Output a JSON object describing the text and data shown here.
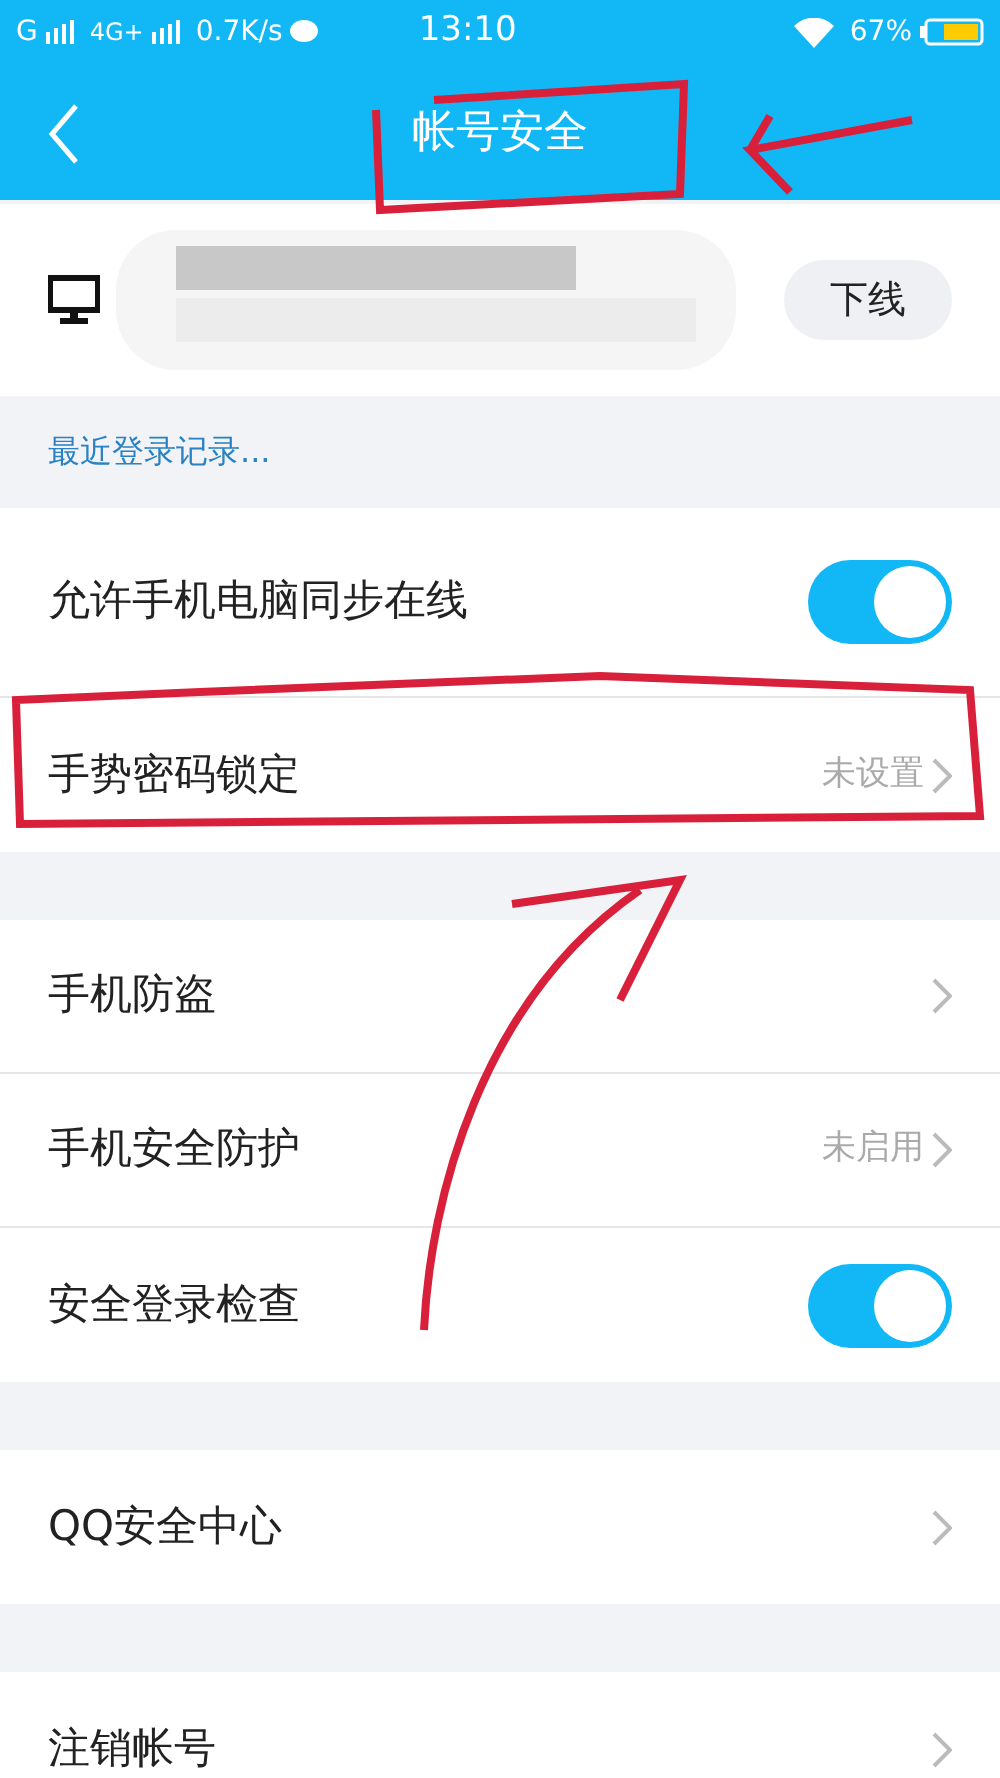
{
  "status_bar": {
    "carrier": "G",
    "network": "4G+",
    "speed": "0.7K/s",
    "time": "13:10",
    "battery": "67%"
  },
  "nav": {
    "title": "帐号安全"
  },
  "device": {
    "button": "下线"
  },
  "recent_login": "最近登录记录...",
  "groups": [
    {
      "rows": [
        {
          "kind": "toggle",
          "label": "允许手机电脑同步在线",
          "on": true
        },
        {
          "kind": "link",
          "label": "手势密码锁定",
          "value": "未设置"
        }
      ]
    },
    {
      "rows": [
        {
          "kind": "link",
          "label": "手机防盗"
        },
        {
          "kind": "link",
          "label": "手机安全防护",
          "value": "未启用"
        },
        {
          "kind": "toggle",
          "label": "安全登录检查",
          "on": true
        }
      ]
    },
    {
      "rows": [
        {
          "kind": "link",
          "label": "QQ安全中心"
        }
      ]
    },
    {
      "rows": [
        {
          "kind": "link",
          "label": "注销帐号"
        }
      ]
    }
  ]
}
